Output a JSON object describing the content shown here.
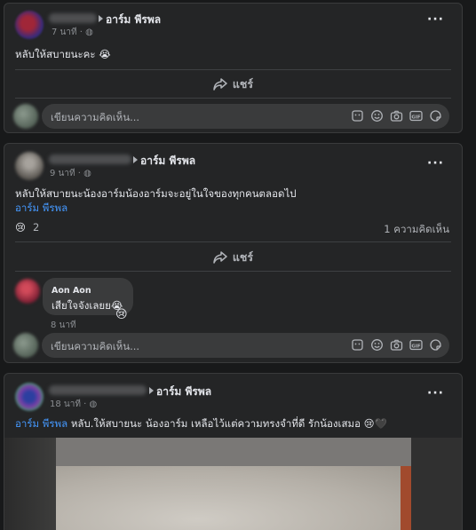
{
  "posts": [
    {
      "page": "อาร์ม พีรพล",
      "time": "7 นาที ·",
      "text": "หลับให้สบายนะคะ 😭",
      "share_label": "แชร์",
      "comment_placeholder": "เขียนความคิดเห็น..."
    },
    {
      "page": "อาร์ม พีรพล",
      "time": "9 นาที ·",
      "text": "หลับให้สบายนะน้องอาร์มน้องอาร์มจะอยู่ในใจของทุกคนตลอดไป",
      "mention": "อาร์ม พีรพล",
      "reaction_emoji": "😢",
      "reaction_count": "2",
      "comment_count": "1 ความคิดเห็น",
      "share_label": "แชร์",
      "comment": {
        "author": "Aon Aon",
        "text": "เสียใจจังเลยย😭",
        "time": "8 นาที",
        "reaction": "😢"
      },
      "comment_placeholder": "เขียนความคิดเห็น..."
    },
    {
      "page": "อาร์ม พีรพล",
      "time": "18 นาที ·",
      "mention": "อาร์ม พีรพล",
      "text": "หลับ.ให้สบายนะ น้องอาร์ม เหลือไว้แต่ความทรงจำที่ดี รักน้องเสมอ 😢🖤"
    }
  ],
  "icons": {
    "more": "more-dots-icon",
    "share": "share-arrow-icon",
    "globe": "globe-icon",
    "comment_tools": [
      "sticker-icon",
      "emoji-icon",
      "camera-icon",
      "gif-icon",
      "sticker-face-icon"
    ]
  },
  "colors": {
    "background": "#18191a",
    "card": "#242526",
    "link": "#4599ff"
  }
}
